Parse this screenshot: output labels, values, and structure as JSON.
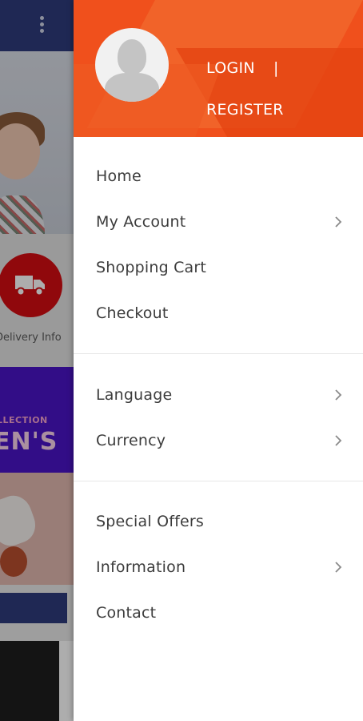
{
  "background_app": {
    "delivery_label": "Delivery Info",
    "banner_line1": "LLECTION",
    "banner_line2": "EN'S",
    "colors": {
      "topbar": "#2e3b7d",
      "delivery_circle": "#d40d12",
      "banner": "#4a14c8"
    }
  },
  "drawer": {
    "header": {
      "login_label": "LOGIN",
      "separator": "|",
      "register_label": "REGISTER",
      "background_color": "#f0501c",
      "avatar_icon": "default-user-avatar"
    },
    "group1": [
      {
        "label": "Home",
        "has_chevron": false
      },
      {
        "label": "My Account",
        "has_chevron": true
      },
      {
        "label": "Shopping Cart",
        "has_chevron": false
      },
      {
        "label": "Checkout",
        "has_chevron": false
      }
    ],
    "group2": [
      {
        "label": "Language",
        "has_chevron": true
      },
      {
        "label": "Currency",
        "has_chevron": true
      }
    ],
    "group3": [
      {
        "label": "Special Offers",
        "has_chevron": false
      },
      {
        "label": "Information",
        "has_chevron": true
      },
      {
        "label": "Contact",
        "has_chevron": false
      }
    ],
    "chevron_icon": "chevron-right-icon"
  }
}
